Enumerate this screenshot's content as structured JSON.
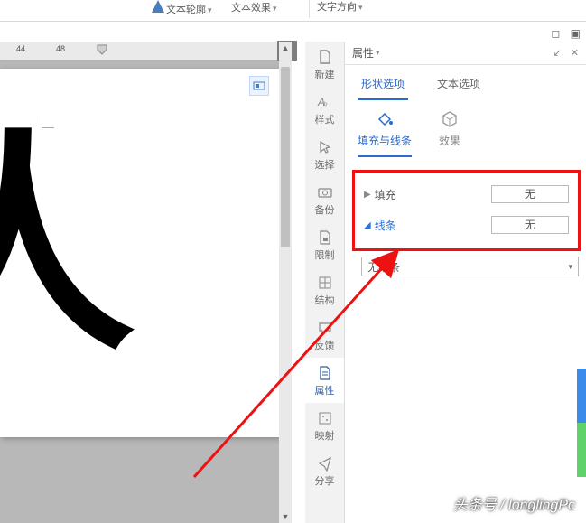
{
  "ribbon": {
    "item1": "文本轮廓",
    "item2": "文本效果",
    "item3": "文字方向"
  },
  "ruler": {
    "n1": "44",
    "n2": "48"
  },
  "sidebar": {
    "items": [
      {
        "label": "新建"
      },
      {
        "label": "样式"
      },
      {
        "label": "选择"
      },
      {
        "label": "备份"
      },
      {
        "label": "限制"
      },
      {
        "label": "结构"
      },
      {
        "label": "反馈"
      },
      {
        "label": "属性"
      },
      {
        "label": "映射"
      },
      {
        "label": "分享"
      }
    ]
  },
  "panel": {
    "title": "属性",
    "tabs": {
      "shape": "形状选项",
      "text": "文本选项"
    },
    "subtabs": {
      "fillline": "填充与线条",
      "effects": "效果"
    },
    "fill": {
      "label": "填充",
      "value": "无"
    },
    "line": {
      "label": "线条",
      "value": "无"
    },
    "combo": "无线条"
  },
  "canvas": {
    "glyph": "人"
  },
  "watermark": "头条号 / longlingPc"
}
